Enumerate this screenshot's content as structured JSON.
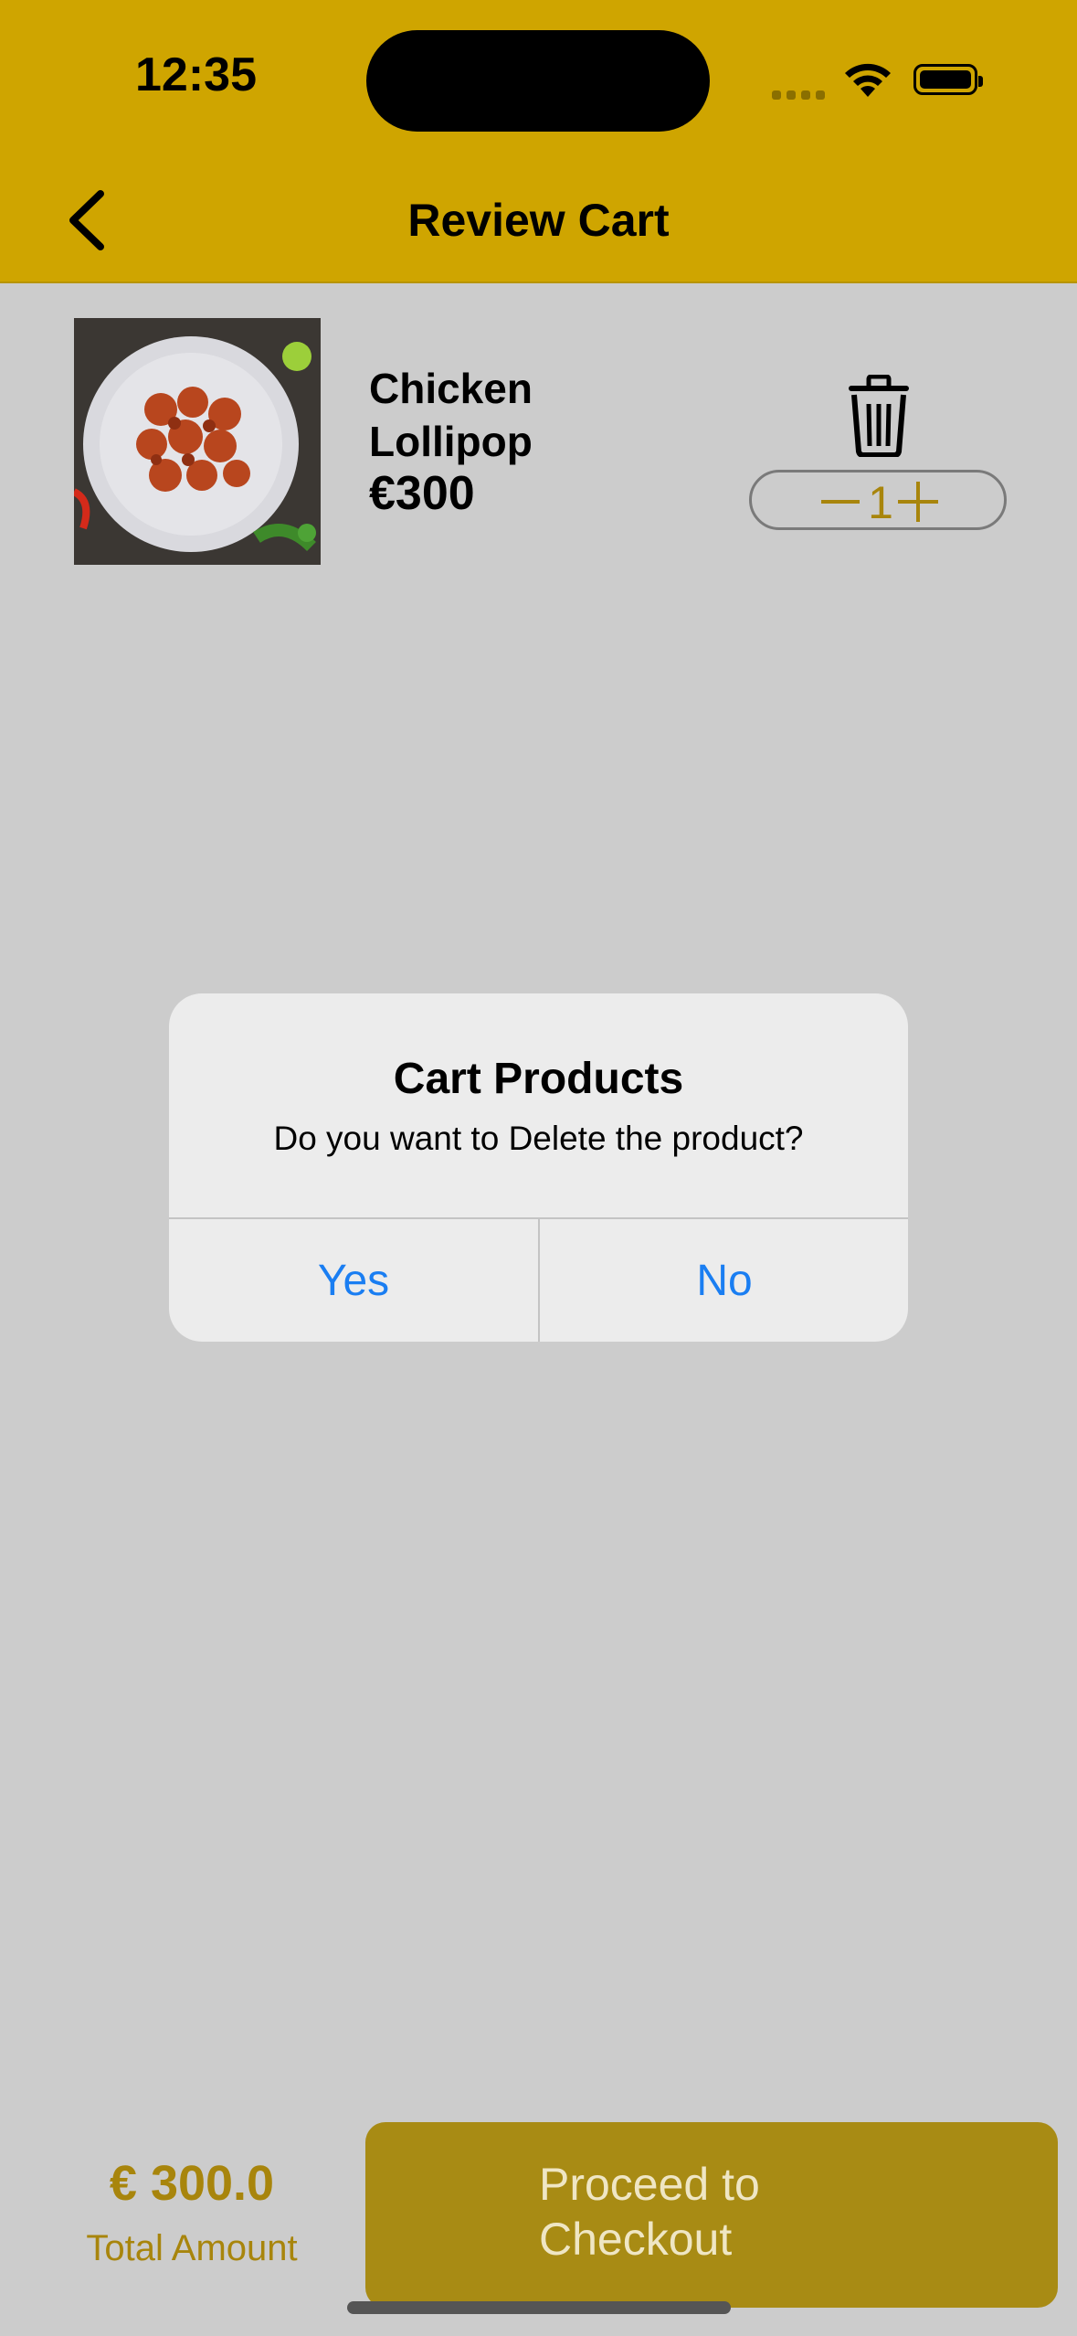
{
  "status_bar": {
    "time": "12:35"
  },
  "header": {
    "title": "Review Cart",
    "back_icon": "chevron-left-icon"
  },
  "cart_items": [
    {
      "name": "Chicken Lollipop",
      "price": "€300",
      "quantity": "1",
      "delete_icon": "trash-icon"
    }
  ],
  "alert": {
    "title": "Cart Products",
    "message": "Do you want to Delete the product?",
    "yes_label": "Yes",
    "no_label": "No"
  },
  "footer": {
    "total_amount": "€ 300.0",
    "total_label": "Total Amount",
    "checkout_label": "Proceed to Checkout"
  },
  "colors": {
    "header_bg": "#cfa500",
    "accent": "#a8850c",
    "alert_button": "#1a7ef2",
    "checkout_bg": "#a88b14"
  }
}
